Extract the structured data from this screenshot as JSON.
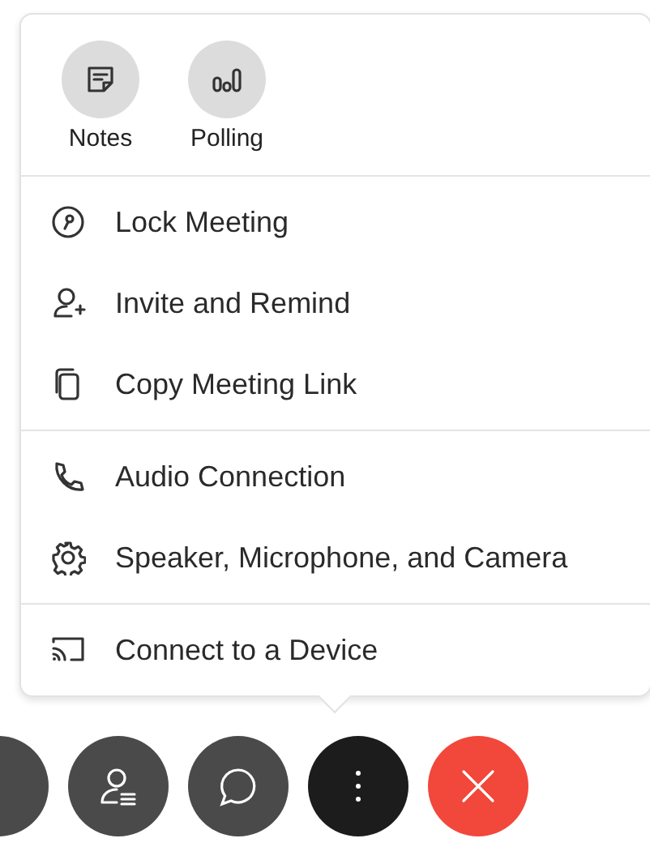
{
  "apps": [
    {
      "label": "Notes",
      "kind": "notes"
    },
    {
      "label": "Polling",
      "kind": "polling"
    }
  ],
  "menu_sections": [
    {
      "items": [
        {
          "label": "Lock Meeting",
          "kind": "lock"
        },
        {
          "label": "Invite and Remind",
          "kind": "invite"
        },
        {
          "label": "Copy Meeting Link",
          "kind": "copy"
        }
      ]
    },
    {
      "items": [
        {
          "label": "Audio Connection",
          "kind": "audio"
        },
        {
          "label": "Speaker, Microphone, and Camera",
          "kind": "settings"
        }
      ]
    },
    {
      "items": [
        {
          "label": "Connect to a Device",
          "kind": "cast"
        }
      ]
    }
  ],
  "call_controls": [
    {
      "kind": "other",
      "selected": false
    },
    {
      "kind": "participants",
      "selected": false
    },
    {
      "kind": "chat",
      "selected": false
    },
    {
      "kind": "more",
      "selected": true
    },
    {
      "kind": "end",
      "selected": false
    }
  ]
}
